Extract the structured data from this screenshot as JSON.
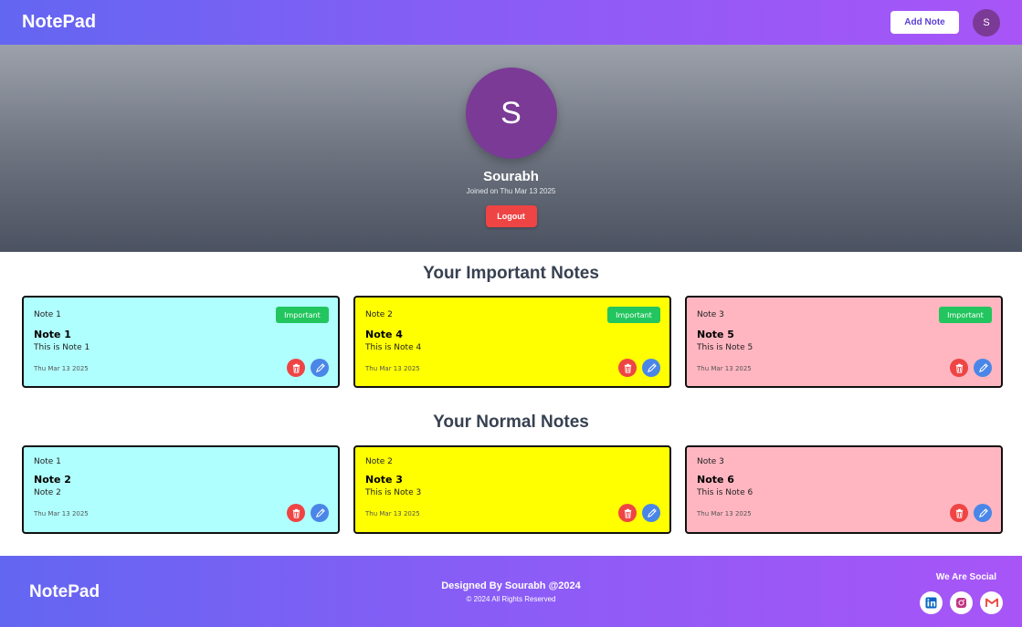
{
  "navbar": {
    "brand": "NotePad",
    "add_note_label": "Add Note",
    "avatar_initial": "S"
  },
  "profile": {
    "avatar_initial": "S",
    "name": "Sourabh",
    "joined": "Joined on Thu Mar 13 2025",
    "logout_label": "Logout"
  },
  "important": {
    "title": "Your Important Notes",
    "badge_label": "Important",
    "notes": [
      {
        "label": "Note 1",
        "title": "Note 1",
        "body": "This is Note 1",
        "date": "Thu Mar 13 2025",
        "color": "#b0ffff"
      },
      {
        "label": "Note 2",
        "title": "Note 4",
        "body": "This is Note 4",
        "date": "Thu Mar 13 2025",
        "color": "#ffff00"
      },
      {
        "label": "Note 3",
        "title": "Note 5",
        "body": "This is Note 5",
        "date": "Thu Mar 13 2025",
        "color": "#ffb6c1"
      }
    ]
  },
  "normal": {
    "title": "Your Normal Notes",
    "notes": [
      {
        "label": "Note 1",
        "title": "Note 2",
        "body": "Note 2",
        "date": "Thu Mar 13 2025",
        "color": "#b0ffff"
      },
      {
        "label": "Note 2",
        "title": "Note 3",
        "body": "This is Note 3",
        "date": "Thu Mar 13 2025",
        "color": "#ffff00"
      },
      {
        "label": "Note 3",
        "title": "Note 6",
        "body": "This is Note 6",
        "date": "Thu Mar 13 2025",
        "color": "#ffb6c1"
      }
    ]
  },
  "footer": {
    "brand": "NotePad",
    "designed_by": "Designed By Sourabh @2024",
    "rights": "© 2024 All Rights Reserved",
    "social_title": "We Are Social",
    "social_icons": [
      "linkedin-icon",
      "instagram-icon",
      "gmail-icon"
    ]
  },
  "colors": {
    "accent_start": "#6366f1",
    "accent_end": "#a855f7",
    "danger": "#ef4444",
    "success": "#22c55e",
    "edit": "#4a86e8"
  }
}
